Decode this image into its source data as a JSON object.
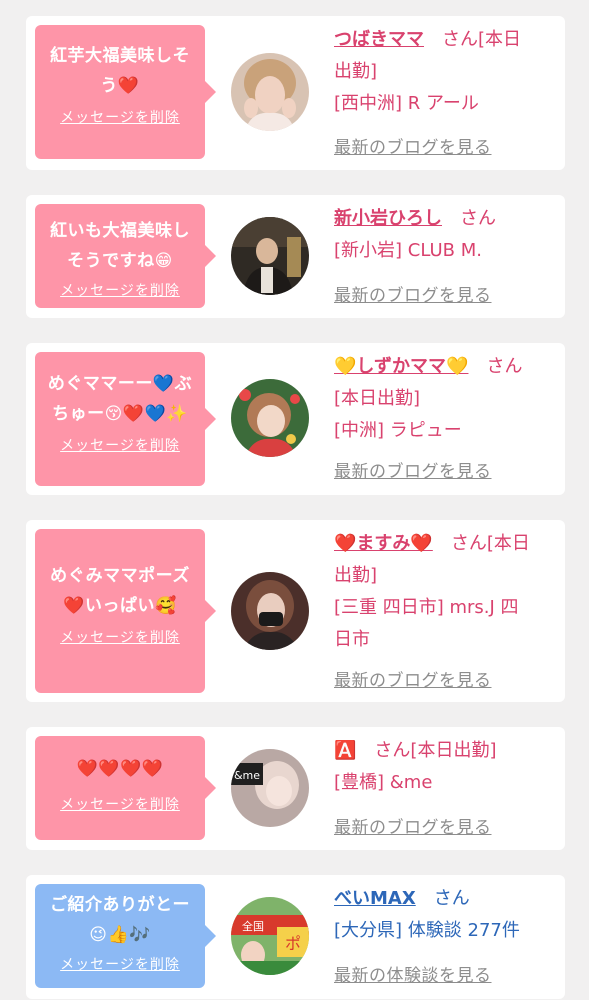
{
  "colors": {
    "background": "#f1f0f0",
    "card": "#ffffff",
    "pink_bubble": "#fe95a8",
    "blue_bubble": "#8cb9f4",
    "pink_text": "#d9426e",
    "blue_text": "#2d67b8",
    "link_gray": "#8d8d8d"
  },
  "cards": [
    {
      "message_lines": [
        "紅芋大福美味しそ",
        "う❤️"
      ],
      "delete_label": "メッセージを削除",
      "name": "つばきママ",
      "suffix": "さん[本日",
      "lines": [
        "出勤]",
        "[西中洲] R アール"
      ],
      "link": "最新のブログを見る"
    },
    {
      "message_lines": [
        "紅いも大福美味し",
        "そうですね😁"
      ],
      "delete_label": "メッセージを削除",
      "name": "新小岩ひろし",
      "suffix": "さん",
      "lines": [
        "[新小岩] CLUB M."
      ],
      "link": "最新のブログを見る"
    },
    {
      "message_lines": [
        "めぐママーー💙ぶ",
        "ちゅー😚❤️💙✨"
      ],
      "delete_label": "メッセージを削除",
      "name": "💛しずかママ💛",
      "suffix": "さん",
      "lines": [
        "[本日出勤]",
        "[中洲] ラピュー"
      ],
      "link": "最新のブログを見る"
    },
    {
      "message_lines": [
        "めぐみママポーズ",
        "❤️いっぱい🥰"
      ],
      "delete_label": "メッセージを削除",
      "name": "❤️ますみ❤️",
      "suffix": "さん[本日",
      "lines": [
        "出勤]",
        "[三重 四日市] mrs.J 四",
        "日市"
      ],
      "link": "最新のブログを見る"
    },
    {
      "message_lines": [
        "❤️❤️❤️❤️"
      ],
      "delete_label": "メッセージを削除",
      "name": "🅰️",
      "suffix": "さん[本日出勤]",
      "lines": [
        "[豊橋] &me"
      ],
      "link": "最新のブログを見る"
    },
    {
      "message_lines": [
        "ご紹介ありがとー",
        "😉👍🎶"
      ],
      "delete_label": "メッセージを削除",
      "name": "べいMAX",
      "suffix": "さん",
      "lines": [
        "[大分県] 体験談 277件"
      ],
      "link": "最新の体験談を見る"
    }
  ],
  "avatar_overlays": {
    "card5_text": "&me",
    "card6_text": "全国",
    "card6_text2": "ポ"
  }
}
